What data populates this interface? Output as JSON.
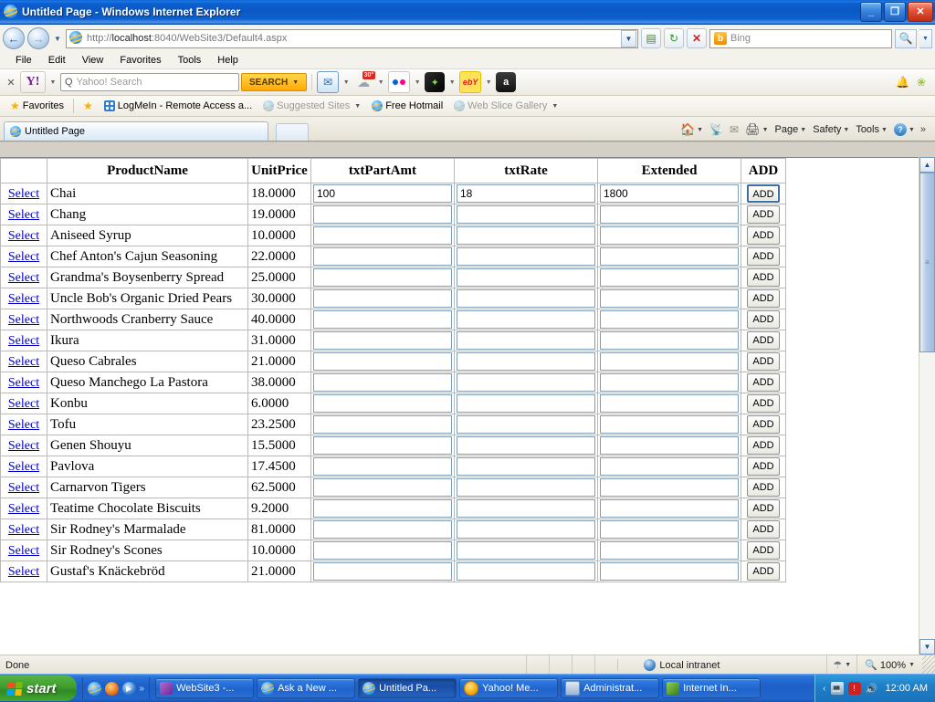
{
  "window": {
    "title": "Untitled Page - Windows Internet Explorer",
    "minimize_label": "_",
    "maximize_label": "❐",
    "close_label": "✕"
  },
  "address_bar": {
    "back_label": "←",
    "forward_label": "→",
    "history_caret": "▼",
    "url_scheme": "http://",
    "url_host": "localhost",
    "url_rest": ":8040/WebSite3/Default4.aspx",
    "url_full": "http://localhost:8040/WebSite3/Default4.aspx",
    "dropdown_caret": "▼",
    "compat_label": "▤",
    "refresh_label": "↻",
    "stop_label": "✕",
    "search_provider": "Bing",
    "search_provider_initial": "b",
    "search_go_label": "🔍",
    "search_caret": "▼"
  },
  "menubar": {
    "items": [
      "File",
      "Edit",
      "View",
      "Favorites",
      "Tools",
      "Help"
    ]
  },
  "yahoo_toolbar": {
    "close_label": "✕",
    "logo_label": "Y!",
    "caret": "▼",
    "search_placeholder": "Yahoo! Search",
    "search_icon": "Q",
    "search_button_label": "SEARCH",
    "search_button_caret": "▼",
    "icons": [
      {
        "name": "mail-icon",
        "glyph": "✉",
        "badge": ""
      },
      {
        "name": "weather-icon",
        "glyph": "☁",
        "badge": "30°"
      },
      {
        "name": "flickr-icon",
        "glyph": "",
        "badge": ""
      },
      {
        "name": "answers-icon",
        "glyph": "✦",
        "badge": ""
      },
      {
        "name": "ebay-icon",
        "glyph": "ebY",
        "badge": ""
      },
      {
        "name": "amazon-icon",
        "glyph": "a",
        "badge": ""
      }
    ],
    "notifications_glyph": "🔔",
    "leaf_glyph": "❀"
  },
  "favorites_bar": {
    "favorites_label": "Favorites",
    "items": [
      {
        "label": "LogMeIn - Remote Access a...",
        "icon": "logmein-icon",
        "caret": "",
        "dim": false
      },
      {
        "label": "Suggested Sites",
        "icon": "ie-icon",
        "caret": "▼",
        "dim": true
      },
      {
        "label": "Free Hotmail",
        "icon": "ie-icon",
        "caret": "",
        "dim": false
      },
      {
        "label": "Web Slice Gallery",
        "icon": "ie-icon",
        "caret": "▼",
        "dim": true
      }
    ]
  },
  "tabs": {
    "active_tab_label": "Untitled Page",
    "new_tab_label": ""
  },
  "command_bar": {
    "home_label": "",
    "home_caret": "▼",
    "feeds_label": "",
    "mail_label": "",
    "print_label": "",
    "print_caret": "▼",
    "page_label": "Page",
    "page_caret": "▼",
    "safety_label": "Safety",
    "safety_caret": "▼",
    "tools_label": "Tools",
    "tools_caret": "▼",
    "help_label": "?",
    "help_caret": "▼",
    "overflow_label": "»"
  },
  "grid": {
    "columns": [
      "",
      "ProductName",
      "UnitPrice",
      "txtPartAmt",
      "txtRate",
      "Extended",
      "ADD"
    ],
    "select_label": "Select",
    "add_label": "ADD",
    "rows": [
      {
        "product": "Chai",
        "price": "18.0000",
        "amt": "100",
        "rate": "18",
        "ext": "1800",
        "focused": true
      },
      {
        "product": "Chang",
        "price": "19.0000",
        "amt": "",
        "rate": "",
        "ext": "",
        "focused": false
      },
      {
        "product": "Aniseed Syrup",
        "price": "10.0000",
        "amt": "",
        "rate": "",
        "ext": "",
        "focused": false
      },
      {
        "product": "Chef Anton's Cajun Seasoning",
        "price": "22.0000",
        "amt": "",
        "rate": "",
        "ext": "",
        "focused": false
      },
      {
        "product": "Grandma's Boysenberry Spread",
        "price": "25.0000",
        "amt": "",
        "rate": "",
        "ext": "",
        "focused": false
      },
      {
        "product": "Uncle Bob's Organic Dried Pears",
        "price": "30.0000",
        "amt": "",
        "rate": "",
        "ext": "",
        "focused": false
      },
      {
        "product": "Northwoods Cranberry Sauce",
        "price": "40.0000",
        "amt": "",
        "rate": "",
        "ext": "",
        "focused": false
      },
      {
        "product": "Ikura",
        "price": "31.0000",
        "amt": "",
        "rate": "",
        "ext": "",
        "focused": false
      },
      {
        "product": "Queso Cabrales",
        "price": "21.0000",
        "amt": "",
        "rate": "",
        "ext": "",
        "focused": false
      },
      {
        "product": "Queso Manchego La Pastora",
        "price": "38.0000",
        "amt": "",
        "rate": "",
        "ext": "",
        "focused": false
      },
      {
        "product": "Konbu",
        "price": "6.0000",
        "amt": "",
        "rate": "",
        "ext": "",
        "focused": false
      },
      {
        "product": "Tofu",
        "price": "23.2500",
        "amt": "",
        "rate": "",
        "ext": "",
        "focused": false
      },
      {
        "product": "Genen Shouyu",
        "price": "15.5000",
        "amt": "",
        "rate": "",
        "ext": "",
        "focused": false
      },
      {
        "product": "Pavlova",
        "price": "17.4500",
        "amt": "",
        "rate": "",
        "ext": "",
        "focused": false
      },
      {
        "product": "Carnarvon Tigers",
        "price": "62.5000",
        "amt": "",
        "rate": "",
        "ext": "",
        "focused": false
      },
      {
        "product": "Teatime Chocolate Biscuits",
        "price": "9.2000",
        "amt": "",
        "rate": "",
        "ext": "",
        "focused": false
      },
      {
        "product": "Sir Rodney's Marmalade",
        "price": "81.0000",
        "amt": "",
        "rate": "",
        "ext": "",
        "focused": false
      },
      {
        "product": "Sir Rodney's Scones",
        "price": "10.0000",
        "amt": "",
        "rate": "",
        "ext": "",
        "focused": false
      },
      {
        "product": "Gustaf's Knäckebröd",
        "price": "21.0000",
        "amt": "",
        "rate": "",
        "ext": "",
        "focused": false
      }
    ]
  },
  "scrollbar": {
    "up_label": "▲",
    "down_label": "▼",
    "thumb_grip": "≡"
  },
  "status_bar": {
    "text": "Done",
    "zone": "Local intranet",
    "zoom": "100%",
    "zoom_caret": "▼",
    "security_caret": "▼"
  },
  "taskbar": {
    "start_label": "start",
    "quick_launch_chevron": "»",
    "tasks": [
      {
        "label": "WebSite3 -...",
        "icon": "visualstudio-icon",
        "active": false
      },
      {
        "label": "Ask a New ...",
        "icon": "ie-icon",
        "active": false
      },
      {
        "label": "Untitled Pa...",
        "icon": "ie-icon",
        "active": true
      },
      {
        "label": "Yahoo! Me...",
        "icon": "yahoo-messenger-icon",
        "active": false
      },
      {
        "label": "Administrat...",
        "icon": "admin-tools-icon",
        "active": false
      },
      {
        "label": "Internet In...",
        "icon": "iis-icon",
        "active": false
      }
    ],
    "tray_chevron": "‹",
    "clock": "12:00 AM"
  }
}
